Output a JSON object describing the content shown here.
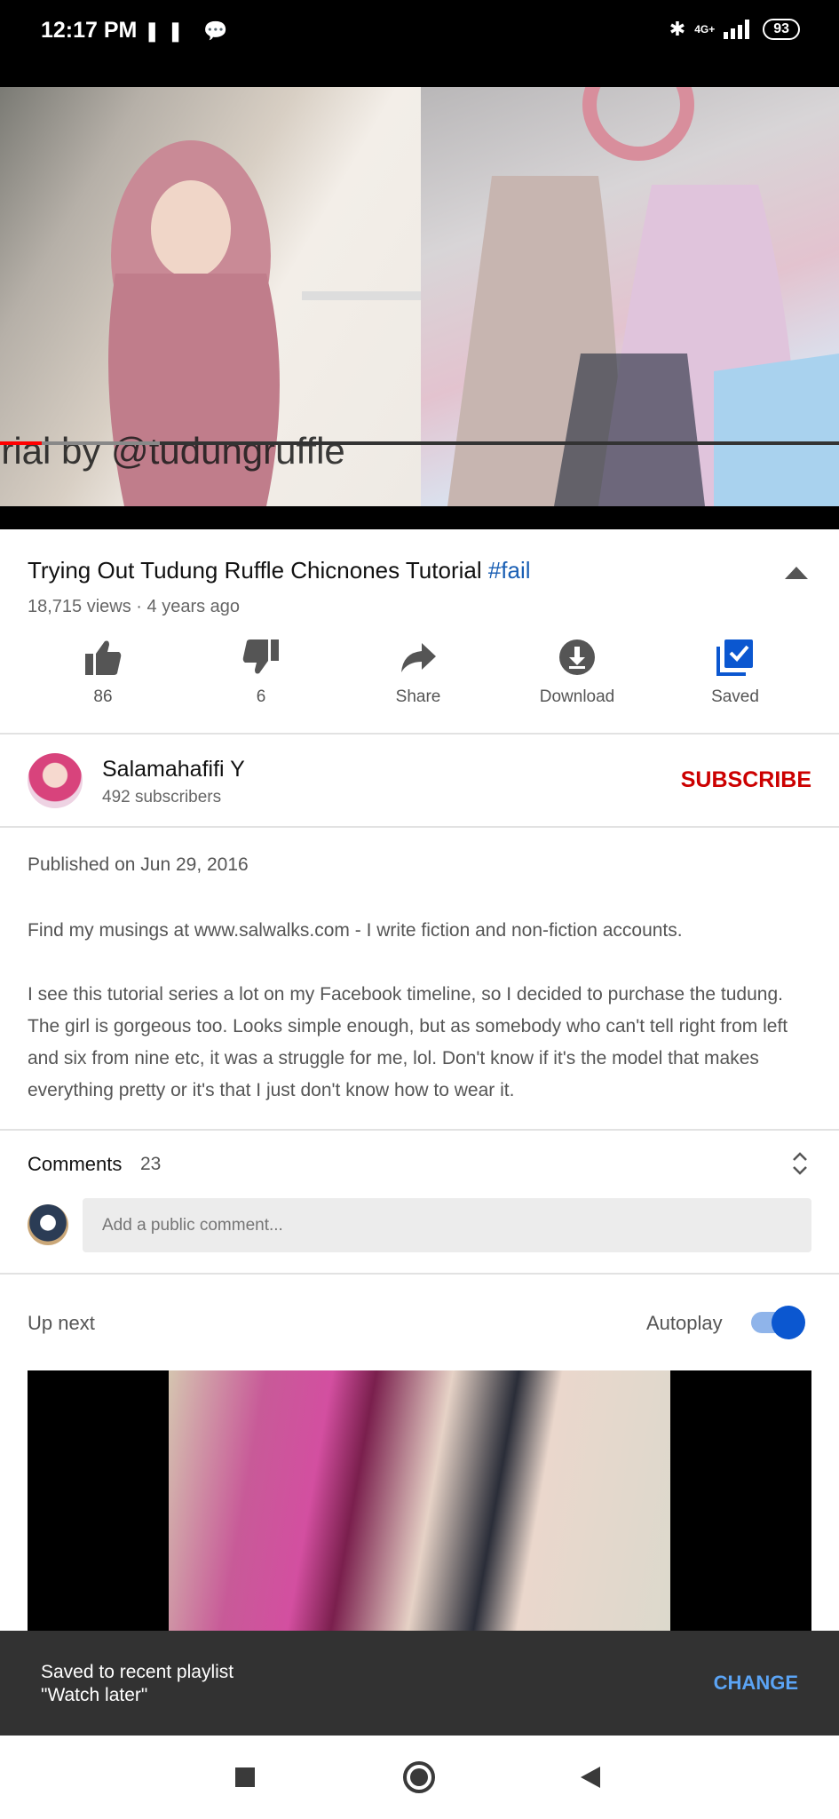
{
  "status_bar": {
    "time": "12:17 PM",
    "left_icons": [
      "pause-icon",
      "chat-icon"
    ],
    "network": "4G+",
    "battery": "93",
    "right_icons": [
      "bluetooth-icon",
      "signal-icon",
      "battery-icon"
    ]
  },
  "video": {
    "overlay_caption": "orial by @tudungruffle",
    "progress_fraction": 0.05,
    "buffer_fraction": 0.19
  },
  "details": {
    "title": "Trying Out Tudung Ruffle Chicnones Tutorial",
    "hashtag": "#fail",
    "views": "18,715 views · 4 years ago"
  },
  "actions": {
    "like_count": "86",
    "dislike_count": "6",
    "share_label": "Share",
    "download_label": "Download",
    "saved_label": "Saved"
  },
  "channel": {
    "name": "Salamahafifi Y",
    "subscribers": "492 subscribers",
    "subscribe_label": "SUBSCRIBE"
  },
  "description": {
    "published": "Published on Jun 29, 2016",
    "paragraph1": "Find my musings at www.salwalks.com - I write fiction and non-fiction accounts.",
    "paragraph2": "I see this tutorial series a lot on my Facebook timeline, so I decided to purchase the tudung. The girl is gorgeous too. Looks simple enough, but as somebody who can't tell right from left and six from nine etc, it was a struggle for me, lol. Don't know if it's the model that makes everything pretty or it's that I just don't know how to wear it."
  },
  "comments": {
    "label": "Comments",
    "count": "23",
    "placeholder": "Add a public comment..."
  },
  "up_next": {
    "label": "Up next",
    "autoplay_label": "Autoplay",
    "autoplay_on": true
  },
  "snackbar": {
    "message": "Saved to recent playlist\n\"Watch later\"",
    "action": "CHANGE"
  },
  "colors": {
    "accent_blue": "#0b57d0",
    "subscribe_red": "#cc0000",
    "progress_red": "#ff0000",
    "snackbar_bg": "#323232",
    "snackbar_action": "#5ba4f5"
  }
}
